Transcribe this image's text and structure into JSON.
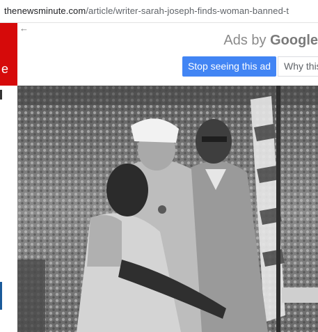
{
  "browser": {
    "url_domain": "thenewsminute.com",
    "url_path": "/article/writer-sarah-joseph-finds-woman-banned-t"
  },
  "sidebar": {
    "partial_text": "e"
  },
  "ad": {
    "back_icon": "back-arrow-icon",
    "ads_by_label": "Ads by",
    "brand_label": "Google",
    "stop_button_label": "Stop seeing this ad",
    "why_button_label": "Why this",
    "stop_button_color": "#4285f4"
  },
  "photo": {
    "description_colors": [
      "#7d7d7d",
      "#d8d8d8",
      "#2a2a2a"
    ]
  }
}
